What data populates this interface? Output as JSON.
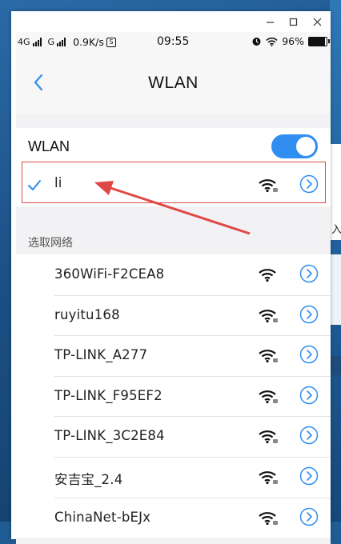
{
  "window": {
    "minimize_icon": "minimize-icon",
    "maximize_icon": "maximize-icon",
    "close_icon": "close-icon"
  },
  "status_bar": {
    "signal_1_label": "4G",
    "signal_2_label": "G",
    "network_speed": "0.9K/s",
    "time": "09:55",
    "battery": "96%",
    "icons": [
      "signal-icon",
      "alarm-icon",
      "wifi-icon",
      "battery-icon"
    ]
  },
  "header": {
    "title": "WLAN",
    "back_icon": "chevron-left-icon"
  },
  "wlan_toggle": {
    "label": "WLAN",
    "enabled": true,
    "accent_color": "#2f8ef0"
  },
  "connected_network": {
    "name": "li",
    "connected": true,
    "check_color": "#2f8ef0",
    "highlight_color": "#e04848"
  },
  "available_networks": {
    "section_title": "选取网络",
    "items": [
      {
        "name": "360WiFi-F2CEA8",
        "locked": false
      },
      {
        "name": "ruyitu168",
        "locked": true
      },
      {
        "name": "TP-LINK_A277",
        "locked": true
      },
      {
        "name": "TP-LINK_F95EF2",
        "locked": true
      },
      {
        "name": "TP-LINK_3C2E84",
        "locked": true
      },
      {
        "name": "安吉宝_2.4",
        "locked": true
      },
      {
        "name": "ChinaNet-bEJx",
        "locked": true
      }
    ]
  },
  "desktop": {
    "partial_text": "入"
  }
}
